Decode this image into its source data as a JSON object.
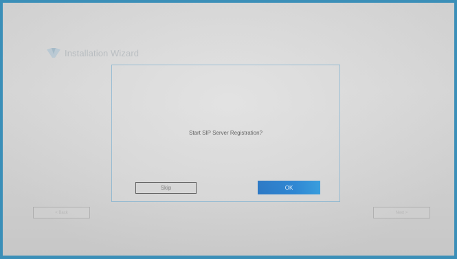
{
  "wizard": {
    "title": "Installation Wizard"
  },
  "dialog": {
    "message": "Start SIP Server Registration?",
    "skip_label": "Skip",
    "ok_label": "OK"
  },
  "navigation": {
    "back_label": "< Back",
    "next_label": "Next >"
  },
  "colors": {
    "frame": "#3b8fb8",
    "accent": "#1e80d4",
    "dialog_border": "#8fb9d3"
  }
}
